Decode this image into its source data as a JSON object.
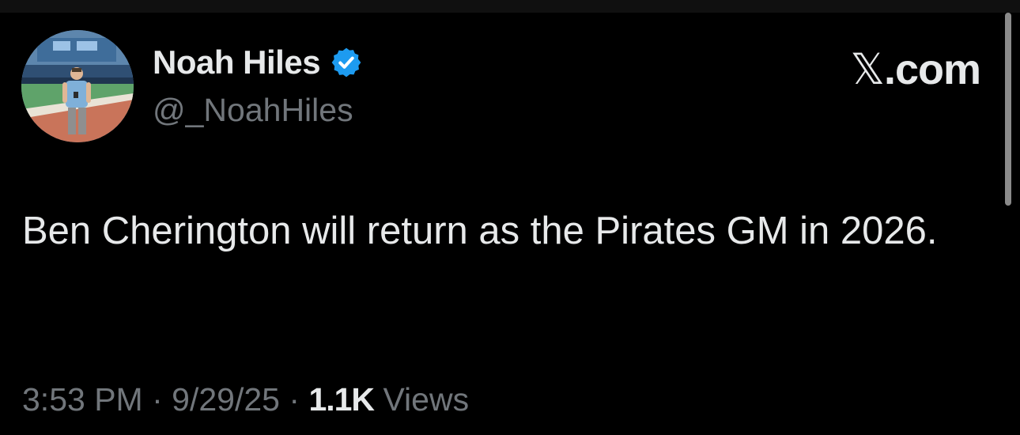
{
  "author": {
    "name": "Noah Hiles",
    "handle": "@_NoahHiles",
    "verified": true,
    "avatar_icon": "profile-photo"
  },
  "brand": {
    "logo_text": "X.com",
    "x_glyph": "𝕏",
    "suffix": ".com"
  },
  "tweet": {
    "text": "Ben Cherington will return as the Pirates GM in 2026."
  },
  "meta": {
    "time": "3:53 PM",
    "date": "9/29/25",
    "separator": "·",
    "views_count": "1.1K",
    "views_label": "Views"
  },
  "colors": {
    "background": "#000000",
    "primary_text": "#e7e9ea",
    "secondary_text": "#71767b",
    "verified_blue": "#1d9bf0"
  }
}
